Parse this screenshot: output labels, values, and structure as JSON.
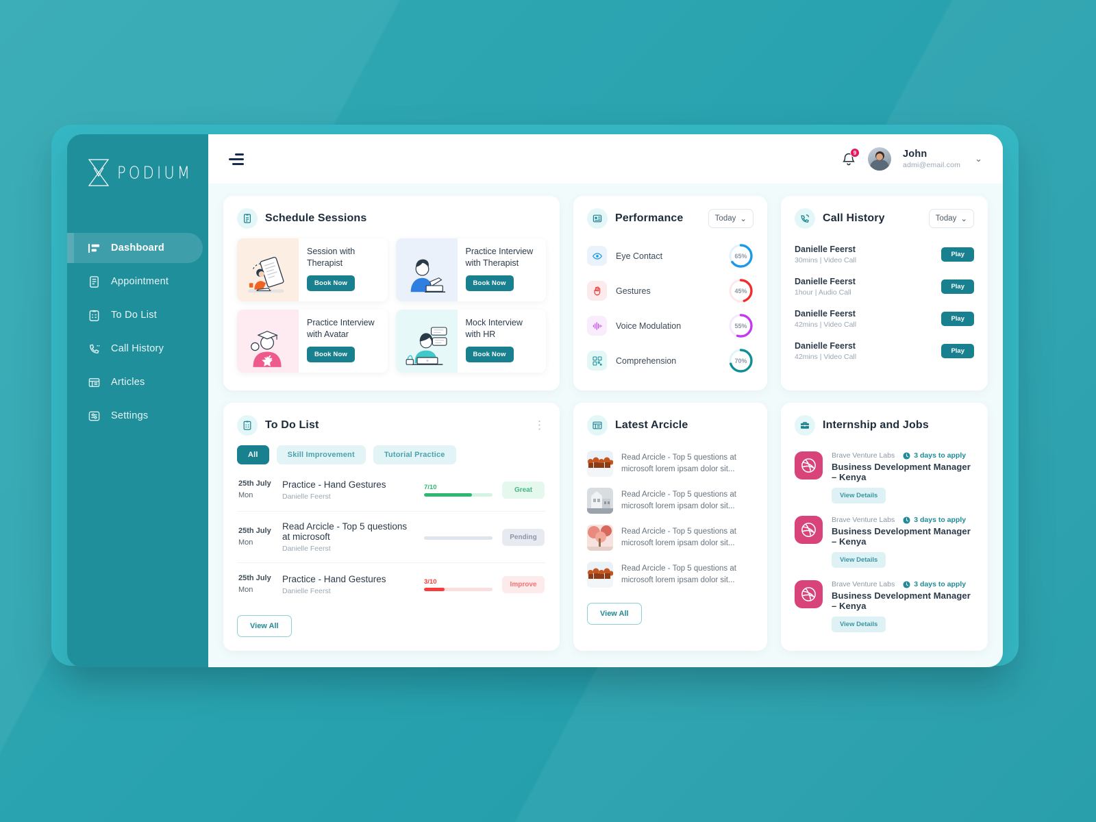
{
  "brand": {
    "name": "PODIUM",
    "logo_icon": "hourglass-x-logo",
    "sidebar_bg": "#1f8f9c",
    "accent": "#18808e"
  },
  "sidebar": {
    "items": [
      {
        "label": "Dashboard",
        "icon": "dashboard-icon",
        "active": true
      },
      {
        "label": "Appointment",
        "icon": "appointment-icon",
        "active": false
      },
      {
        "label": "To Do List",
        "icon": "todo-icon",
        "active": false
      },
      {
        "label": "Call History",
        "icon": "call-history-icon",
        "active": false
      },
      {
        "label": "Articles",
        "icon": "articles-icon",
        "active": false
      },
      {
        "label": "Settings",
        "icon": "settings-icon",
        "active": false
      }
    ]
  },
  "topbar": {
    "menu_icon": "hamburger-icon",
    "bell_icon": "bell-icon",
    "notification_count": "9",
    "user_name": "John",
    "user_email": "admi@email.com",
    "chevron": "⌄"
  },
  "schedule": {
    "title": "Schedule Sessions",
    "icon": "clipboard-icon",
    "cards": [
      {
        "title": "Session with Therapist",
        "button": "Book Now",
        "art": "reading-person",
        "bg": "#fdeee4"
      },
      {
        "title": "Practice Interview with Therapist",
        "button": "Book Now",
        "art": "man-laptop",
        "bg": "#eaf1fb"
      },
      {
        "title": "Practice Interview with Avatar",
        "button": "Book Now",
        "art": "graduate-person",
        "bg": "#fdebf1"
      },
      {
        "title": "Mock Interview with HR",
        "button": "Book Now",
        "art": "woman-laptop",
        "bg": "#e6f8f8"
      }
    ]
  },
  "performance": {
    "title": "Performance",
    "icon": "performance-icon",
    "filter": "Today",
    "metrics": [
      {
        "label": "Eye Contact",
        "value": "65%",
        "pct": 65,
        "color": "#1b9ae8",
        "track": "#e3f1fb",
        "icon": "eye-icon",
        "icon_bg": "#eaf2fc"
      },
      {
        "label": "Gestures",
        "value": "45%",
        "pct": 45,
        "color": "#f42b2b",
        "track": "#fde9e9",
        "icon": "hand-icon",
        "icon_bg": "#fdeaea"
      },
      {
        "label": "Voice Modulation",
        "value": "55%",
        "pct": 55,
        "color": "#c43af0",
        "track": "#f7e9fd",
        "icon": "waveform-icon",
        "icon_bg": "#f9ecfd"
      },
      {
        "label": "Comprehension",
        "value": "70%",
        "pct": 70,
        "color": "#0f8e96",
        "track": "#e1f5f6",
        "icon": "qr-icon",
        "icon_bg": "#e4f7f7"
      }
    ]
  },
  "call_history": {
    "title": "Call History",
    "icon": "phone-icon",
    "filter": "Today",
    "rows": [
      {
        "name": "Danielle Feerst",
        "meta": "30mins | Video Call",
        "button": "Play"
      },
      {
        "name": "Danielle Feerst",
        "meta": "1hour | Audio Call",
        "button": "Play"
      },
      {
        "name": "Danielle Feerst",
        "meta": "42mins | Video Call",
        "button": "Play"
      },
      {
        "name": "Danielle Feerst",
        "meta": "42mins | Video Call",
        "button": "Play"
      }
    ]
  },
  "todo": {
    "title": "To Do List",
    "icon": "todo-list-icon",
    "menu_icon": "kebab-menu-icon",
    "filters": [
      {
        "label": "All",
        "active": true
      },
      {
        "label": "Skill Improvement",
        "active": false
      },
      {
        "label": "Tutorial Practice",
        "active": false
      }
    ],
    "rows": [
      {
        "date": "25th July",
        "day": "Mon",
        "title": "Practice - Hand Gestures",
        "person": "Danielle Feerst",
        "score": "7/10",
        "pct": 70,
        "fill": "#2eb872",
        "track": "#d5f3e3",
        "badge": "Great",
        "badge_bg": "#e4f8ed",
        "badge_color": "#44b883"
      },
      {
        "date": "25th July",
        "day": "Mon",
        "title": "Read Arcicle - Top 5 questions at microsoft",
        "person": "Danielle Feerst",
        "score": "",
        "pct": 0,
        "fill": "#d8dee6",
        "track": "#dfe5ec",
        "badge": "Pending",
        "badge_bg": "#e7ebf1",
        "badge_color": "#8b97a8"
      },
      {
        "date": "25th July",
        "day": "Mon",
        "title": "Practice - Hand Gestures",
        "person": "Danielle Feerst",
        "score": "3/10",
        "pct": 30,
        "fill": "#f83b3b",
        "track": "#fcdede",
        "badge": "Improve",
        "badge_bg": "#fdeaea",
        "badge_color": "#f5706f"
      }
    ],
    "view_all": "View All"
  },
  "articles": {
    "title": "Latest Arcicle",
    "icon": "article-icon",
    "rows": [
      {
        "text": "Read Arcicle - Top 5 questions at microsoft lorem ipsam dolor sit...",
        "thumb": "crowd-photo"
      },
      {
        "text": "Read Arcicle - Top 5 questions at microsoft lorem ipsam dolor sit...",
        "thumb": "building-photo"
      },
      {
        "text": "Read Arcicle - Top 5 questions at microsoft lorem ipsam dolor sit...",
        "thumb": "autumn-photo"
      },
      {
        "text": "Read Arcicle - Top 5 questions at microsoft lorem ipsam dolor sit...",
        "thumb": "crowd-photo"
      }
    ],
    "view_all": "View All"
  },
  "jobs": {
    "title": "Internship and Jobs",
    "icon": "briefcase-icon",
    "rows": [
      {
        "company": "Brave Venture Labs",
        "days": "3 days to apply",
        "title": "Business Development Manager – Kenya",
        "button": "View Details",
        "logo": "dribbble-icon"
      },
      {
        "company": "Brave Venture Labs",
        "days": "3 days to apply",
        "title": "Business Development Manager – Kenya",
        "button": "View Details",
        "logo": "dribbble-icon"
      },
      {
        "company": "Brave Venture Labs",
        "days": "3 days to apply",
        "title": "Business Development Manager – Kenya",
        "button": "View Details",
        "logo": "dribbble-icon"
      }
    ]
  }
}
